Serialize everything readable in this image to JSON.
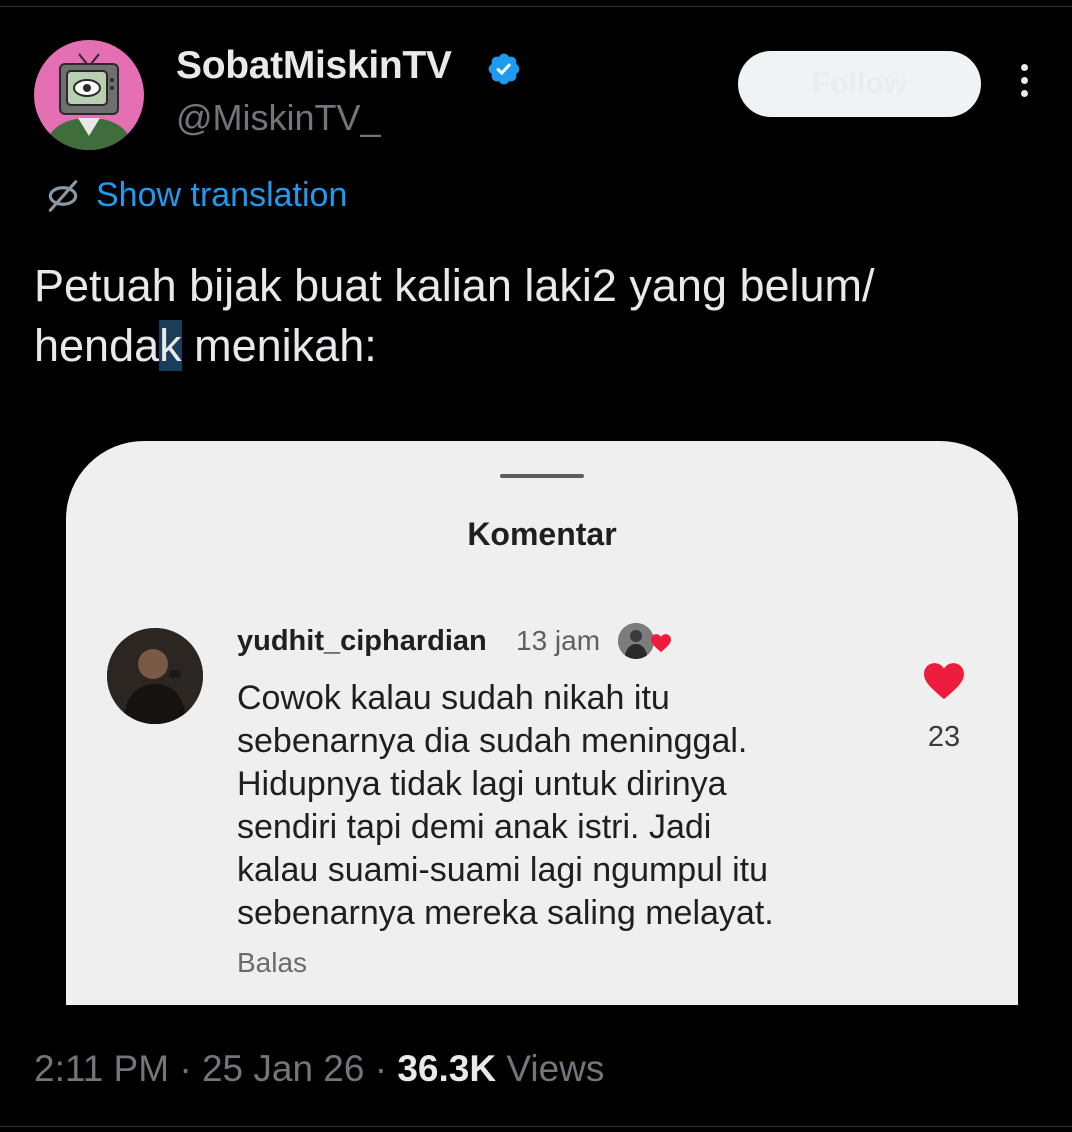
{
  "tweet": {
    "author_name": "SobatMiskinTV",
    "author_handle": "@MiskinTV_",
    "follow_label": "Follow",
    "translate_label": "Show translation",
    "text_lines": [
      "Petuah bijak buat kalian laki2 yang belum/",
      "hendak menikah:"
    ],
    "text_line2_before": "henda",
    "text_line2_selected": "k",
    "text_line2_after": " menikah:",
    "time": "2:11 PM",
    "date": "25 Jan 26",
    "views_count": "36.3K",
    "views_label": "Views",
    "separator": "·"
  },
  "media": {
    "sheet_title": "Komentar",
    "comment": {
      "username": "yudhit_ciphardian",
      "time": "13 jam",
      "text_lines": [
        "Cowok kalau sudah nikah itu",
        "sebenarnya dia sudah meninggal.",
        "Hidupnya tidak lagi untuk dirinya",
        "sendiri tapi demi anak istri. Jadi",
        "kalau suami-suami lagi ngumpul itu",
        "sebenarnya mereka saling melayat."
      ],
      "reply_label": "Balas",
      "likes": "23"
    }
  },
  "icons": {
    "verified": "verified-badge-icon",
    "more": "more-options-icon",
    "translate": "translate-globe-icon",
    "heart": "heart-icon"
  },
  "colors": {
    "background": "#000000",
    "link_blue": "#1d9bf0",
    "verified_blue": "#1d9bf0",
    "heart_red": "#ed1c3c",
    "avatar_pink": "#e46fb2",
    "follow_button": "#eff3f4"
  }
}
